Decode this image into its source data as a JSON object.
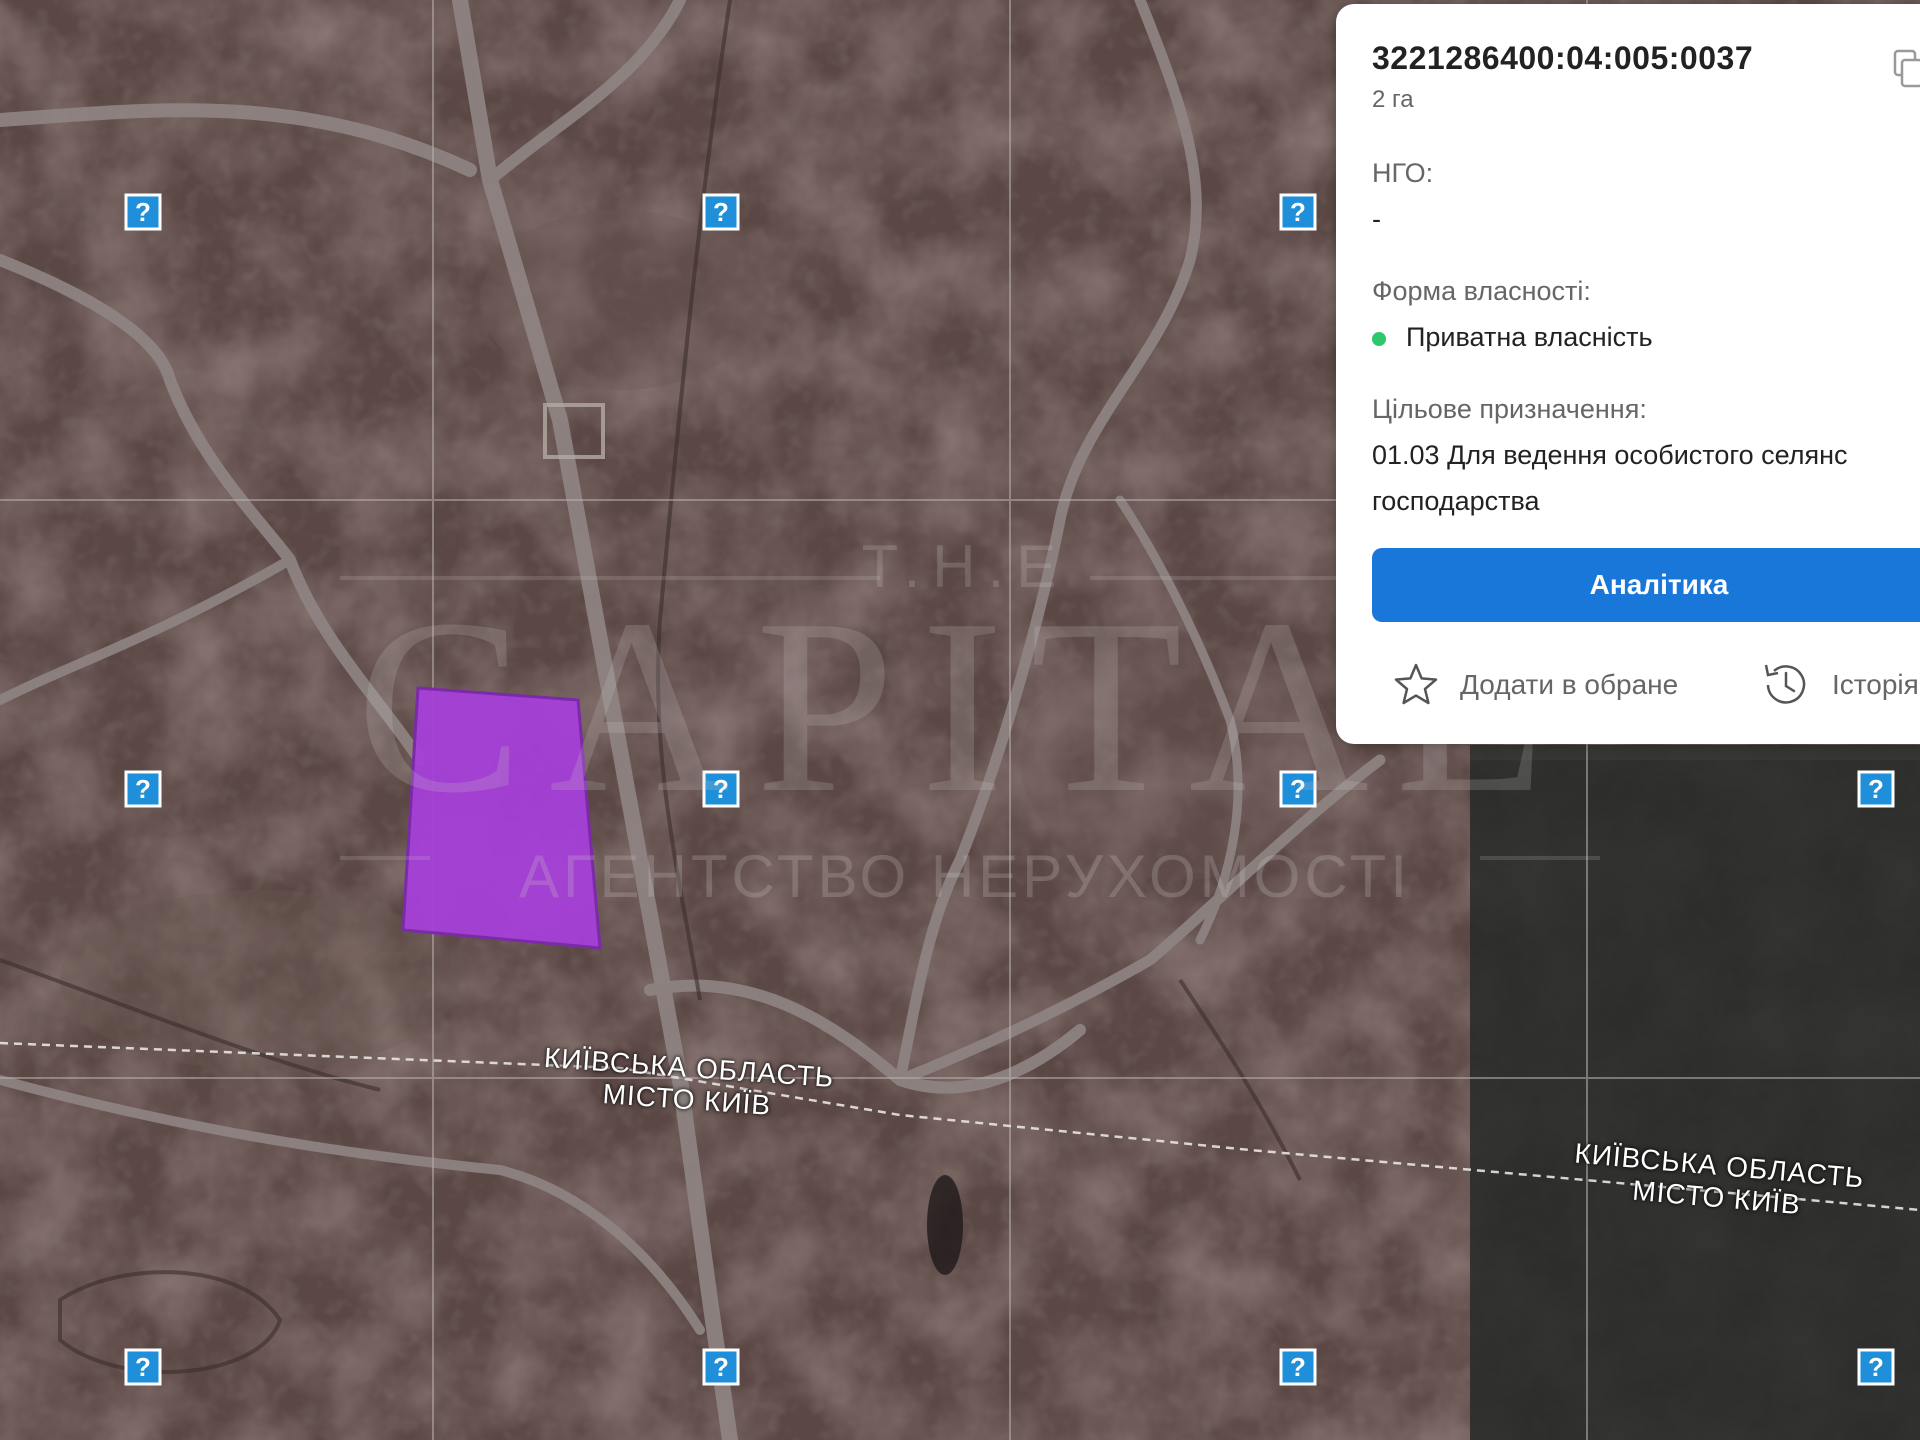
{
  "parcel": {
    "cadastral_number": "3221286400:04:005:0037",
    "area": "2 га",
    "ngo_label": "НГО:",
    "ngo_value": "-",
    "ownership_label": "Форма власності:",
    "ownership_value": "Приватна власність",
    "ownership_status_color": "#2ec76a",
    "purpose_label": "Цільове призначення:",
    "purpose_line1": "01.03 Для ведення особистого селянс",
    "purpose_line2": "господарства"
  },
  "actions": {
    "analytics_label": "Аналітика",
    "favorite_label": "Додати в обране",
    "history_label": "Історія"
  },
  "map_labels": {
    "boundary_1_line1": "КИЇВСЬКА ОБЛАСТЬ",
    "boundary_1_line2": "МІСТО КИЇВ",
    "boundary_2_line1": "КИЇВСЬКА ОБЛАСТЬ",
    "boundary_2_line2": "МІСТО КИЇВ",
    "marker_symbol": "?"
  },
  "watermark": {
    "top": "T.H.E",
    "main": "CAPITAL",
    "sub": "АГЕНТСТВО НЕРУХОМОСТІ"
  },
  "colors": {
    "parcel_fill": "#a53fd9",
    "button": "#1877d8",
    "marker": "#1e8fd8"
  },
  "icons": {
    "copy": "copy-icon",
    "favorite": "star-icon",
    "history": "history-icon",
    "marker": "question-marker-icon"
  }
}
